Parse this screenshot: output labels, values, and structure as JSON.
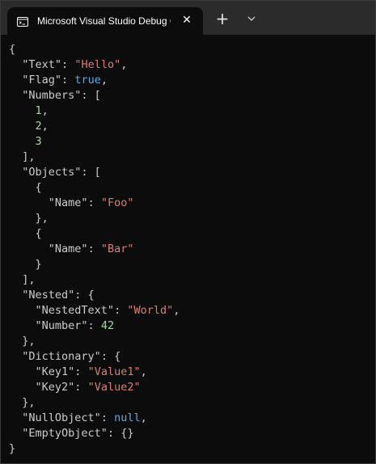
{
  "window": {
    "tab_title": "Microsoft Visual Studio Debug Console",
    "close_glyph": "✕",
    "new_tab_glyph": "+",
    "tab_icon": "console-icon",
    "dropdown_icon": "chevron-down-icon"
  },
  "colors": {
    "background": "#0c0c0c",
    "titlebar": "#2b2b2b",
    "string": "#d77f78",
    "keyword": "#5fa8e0",
    "number": "#a9d7a1",
    "punctuation": "#cccccc"
  },
  "console_lines": [
    [
      {
        "t": "p",
        "v": "{"
      }
    ],
    [
      {
        "t": "p",
        "v": "  "
      },
      {
        "t": "k",
        "v": "\"Text\""
      },
      {
        "t": "p",
        "v": ": "
      },
      {
        "t": "s",
        "v": "\"Hello\""
      },
      {
        "t": "p",
        "v": ","
      }
    ],
    [
      {
        "t": "p",
        "v": "  "
      },
      {
        "t": "k",
        "v": "\"Flag\""
      },
      {
        "t": "p",
        "v": ": "
      },
      {
        "t": "b",
        "v": "true"
      },
      {
        "t": "p",
        "v": ","
      }
    ],
    [
      {
        "t": "p",
        "v": "  "
      },
      {
        "t": "k",
        "v": "\"Numbers\""
      },
      {
        "t": "p",
        "v": ": ["
      }
    ],
    [
      {
        "t": "p",
        "v": "    "
      },
      {
        "t": "n",
        "v": "1"
      },
      {
        "t": "p",
        "v": ","
      }
    ],
    [
      {
        "t": "p",
        "v": "    "
      },
      {
        "t": "n",
        "v": "2"
      },
      {
        "t": "p",
        "v": ","
      }
    ],
    [
      {
        "t": "p",
        "v": "    "
      },
      {
        "t": "n",
        "v": "3"
      }
    ],
    [
      {
        "t": "p",
        "v": "  ],"
      }
    ],
    [
      {
        "t": "p",
        "v": "  "
      },
      {
        "t": "k",
        "v": "\"Objects\""
      },
      {
        "t": "p",
        "v": ": ["
      }
    ],
    [
      {
        "t": "p",
        "v": "    {"
      }
    ],
    [
      {
        "t": "p",
        "v": "      "
      },
      {
        "t": "k",
        "v": "\"Name\""
      },
      {
        "t": "p",
        "v": ": "
      },
      {
        "t": "s",
        "v": "\"Foo\""
      }
    ],
    [
      {
        "t": "p",
        "v": "    },"
      }
    ],
    [
      {
        "t": "p",
        "v": "    {"
      }
    ],
    [
      {
        "t": "p",
        "v": "      "
      },
      {
        "t": "k",
        "v": "\"Name\""
      },
      {
        "t": "p",
        "v": ": "
      },
      {
        "t": "s",
        "v": "\"Bar\""
      }
    ],
    [
      {
        "t": "p",
        "v": "    }"
      }
    ],
    [
      {
        "t": "p",
        "v": "  ],"
      }
    ],
    [
      {
        "t": "p",
        "v": "  "
      },
      {
        "t": "k",
        "v": "\"Nested\""
      },
      {
        "t": "p",
        "v": ": {"
      }
    ],
    [
      {
        "t": "p",
        "v": "    "
      },
      {
        "t": "k",
        "v": "\"NestedText\""
      },
      {
        "t": "p",
        "v": ": "
      },
      {
        "t": "s",
        "v": "\"World\""
      },
      {
        "t": "p",
        "v": ","
      }
    ],
    [
      {
        "t": "p",
        "v": "    "
      },
      {
        "t": "k",
        "v": "\"Number\""
      },
      {
        "t": "p",
        "v": ": "
      },
      {
        "t": "n",
        "v": "42"
      }
    ],
    [
      {
        "t": "p",
        "v": "  },"
      }
    ],
    [
      {
        "t": "p",
        "v": "  "
      },
      {
        "t": "k",
        "v": "\"Dictionary\""
      },
      {
        "t": "p",
        "v": ": {"
      }
    ],
    [
      {
        "t": "p",
        "v": "    "
      },
      {
        "t": "k",
        "v": "\"Key1\""
      },
      {
        "t": "p",
        "v": ": "
      },
      {
        "t": "s",
        "v": "\"Value1\""
      },
      {
        "t": "p",
        "v": ","
      }
    ],
    [
      {
        "t": "p",
        "v": "    "
      },
      {
        "t": "k",
        "v": "\"Key2\""
      },
      {
        "t": "p",
        "v": ": "
      },
      {
        "t": "s",
        "v": "\"Value2\""
      }
    ],
    [
      {
        "t": "p",
        "v": "  },"
      }
    ],
    [
      {
        "t": "p",
        "v": "  "
      },
      {
        "t": "k",
        "v": "\"NullObject\""
      },
      {
        "t": "p",
        "v": ": "
      },
      {
        "t": "b",
        "v": "null"
      },
      {
        "t": "p",
        "v": ","
      }
    ],
    [
      {
        "t": "p",
        "v": "  "
      },
      {
        "t": "k",
        "v": "\"EmptyObject\""
      },
      {
        "t": "p",
        "v": ": {}"
      }
    ],
    [
      {
        "t": "p",
        "v": "}"
      }
    ]
  ]
}
